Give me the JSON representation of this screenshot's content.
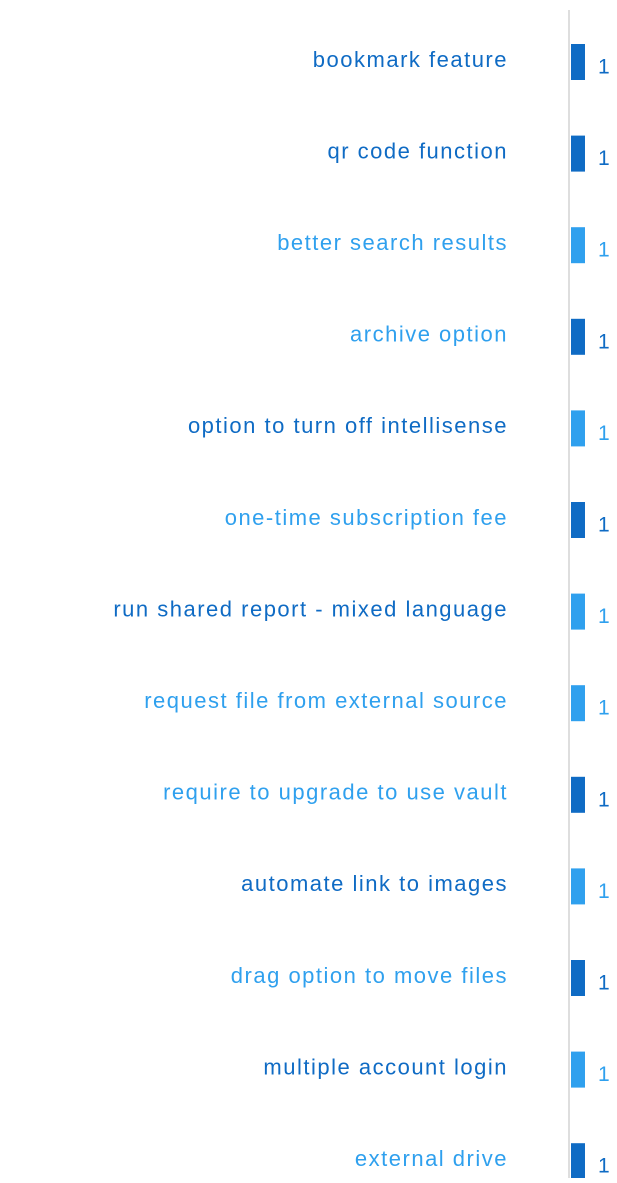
{
  "chart_data": {
    "type": "bar",
    "orientation": "horizontal",
    "categories": [
      "bookmark feature",
      "qr code function",
      "better search results",
      "archive option",
      "option to turn off intellisense",
      "one-time subscription fee",
      "run shared report - mixed language",
      "request file from external source",
      "require to upgrade to use vault",
      "automate link to images",
      "drag option to move files",
      "multiple account login",
      "external drive"
    ],
    "values": [
      1,
      1,
      1,
      1,
      1,
      1,
      1,
      1,
      1,
      1,
      1,
      1,
      1
    ],
    "color_keys": [
      "dark",
      "dark",
      "light",
      "dark",
      "light",
      "dark",
      "light",
      "light",
      "dark",
      "light",
      "dark",
      "light",
      "dark"
    ],
    "label_color_keys": [
      "dark",
      "dark",
      "light",
      "light",
      "dark",
      "light",
      "dark",
      "light",
      "light",
      "dark",
      "light",
      "dark",
      "light"
    ],
    "value_label_color_keys": [
      "dark",
      "dark",
      "light",
      "dark",
      "light",
      "dark",
      "light",
      "light",
      "dark",
      "light",
      "dark",
      "light",
      "dark"
    ],
    "colors": {
      "dark": "#0f6bc4",
      "light": "#2fa0ee",
      "axis": "#c8c8c8"
    },
    "xlim": [
      0,
      1
    ],
    "grid": false,
    "title": "",
    "xlabel": "",
    "ylabel": ""
  }
}
